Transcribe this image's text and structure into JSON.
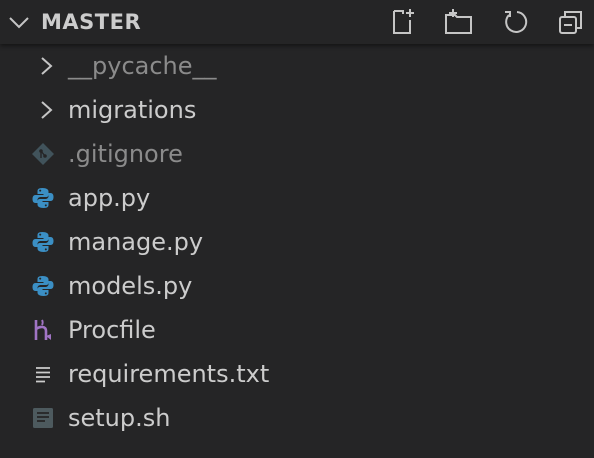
{
  "section": {
    "title": "MASTER",
    "actions": [
      {
        "name": "new-file-icon"
      },
      {
        "name": "new-folder-icon"
      },
      {
        "name": "refresh-icon"
      },
      {
        "name": "collapse-all-icon"
      }
    ]
  },
  "tree": {
    "items": [
      {
        "label": "__pycache__",
        "kind": "folder",
        "icon": "chevron-right-icon",
        "dimmed": true
      },
      {
        "label": "migrations",
        "kind": "folder",
        "icon": "chevron-right-icon",
        "dimmed": false
      },
      {
        "label": ".gitignore",
        "kind": "file",
        "icon": "git-icon",
        "dimmed": true
      },
      {
        "label": "app.py",
        "kind": "file",
        "icon": "python-icon",
        "dimmed": false
      },
      {
        "label": "manage.py",
        "kind": "file",
        "icon": "python-icon",
        "dimmed": false
      },
      {
        "label": "models.py",
        "kind": "file",
        "icon": "python-icon",
        "dimmed": false
      },
      {
        "label": "Procfile",
        "kind": "file",
        "icon": "heroku-icon",
        "dimmed": false
      },
      {
        "label": "requirements.txt",
        "kind": "file",
        "icon": "text-file-icon",
        "dimmed": false
      },
      {
        "label": "setup.sh",
        "kind": "file",
        "icon": "shell-script-icon",
        "dimmed": false
      }
    ]
  },
  "colors": {
    "background": "#252526",
    "text": "#cccccc",
    "dimmed_text": "#8b8b8b",
    "python_blue": "#3b8fc4",
    "git_gray": "#41535b",
    "heroku_purple": "#a074c4"
  }
}
